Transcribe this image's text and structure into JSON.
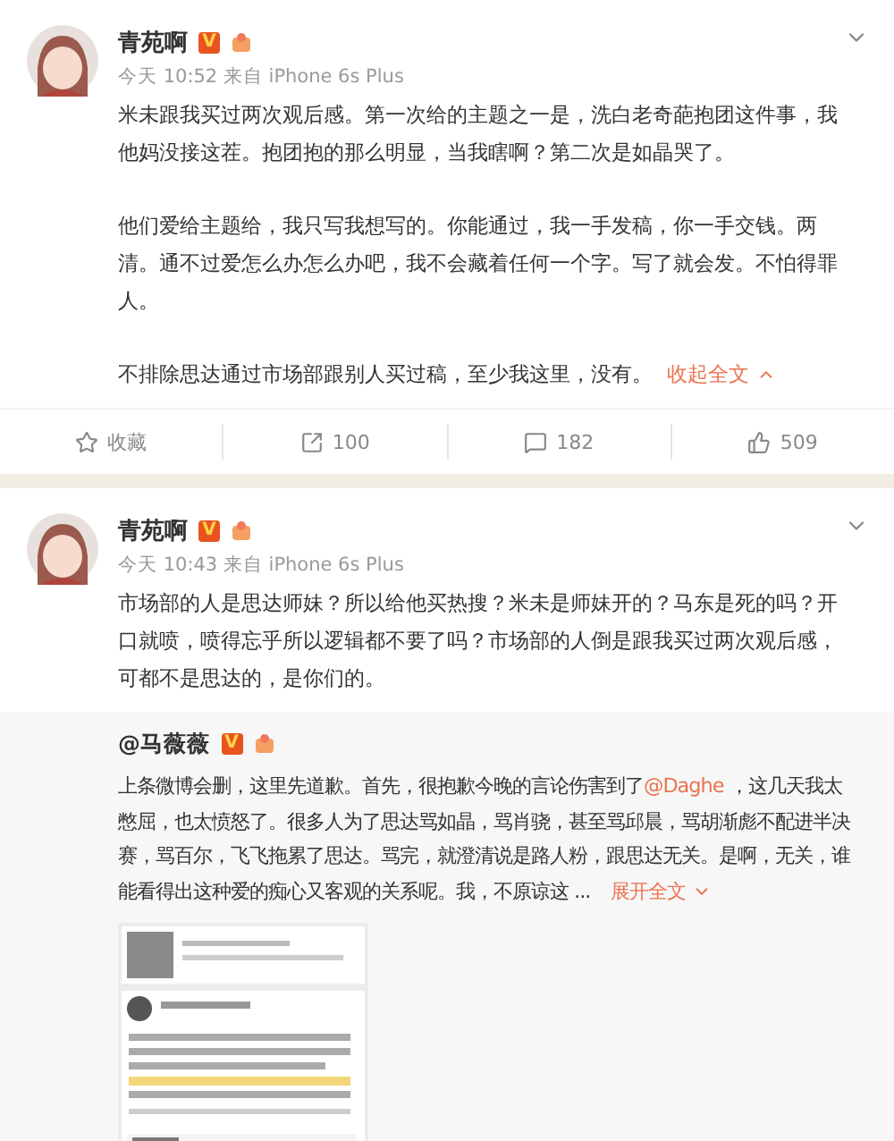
{
  "posts": [
    {
      "author": "青苑啊",
      "verified_badge": "V",
      "meta": "今天 10:52 来自 iPhone 6s Plus",
      "paragraphs": [
        "米未跟我买过两次观后感。第一次给的主题之一是，洗白老奇葩抱团这件事，我他妈没接这茬。抱团抱的那么明显，当我瞎啊？第二次是如晶哭了。",
        "他们爱给主题给，我只写我想写的。你能通过，我一手发稿，你一手交钱。两清。通不过爱怎么办怎么办吧，我不会藏着任何一个字。写了就会发。不怕得罪人。",
        "不排除思达通过市场部跟别人买过稿，至少我这里，没有。"
      ],
      "toggle": {
        "label": "收起全文",
        "expanded": true
      },
      "actions": [
        {
          "kind": "favorite",
          "label": "收藏"
        },
        {
          "kind": "repost",
          "label": "100"
        },
        {
          "kind": "comment",
          "label": "182"
        },
        {
          "kind": "like",
          "label": "509"
        }
      ]
    },
    {
      "author": "青苑啊",
      "verified_badge": "V",
      "meta": "今天 10:43 来自 iPhone 6s Plus",
      "paragraphs": [
        "市场部的人是思达师妹？所以给他买热搜？米未是师妹开的？马东是死的吗？开口就喷，喷得忘乎所以逻辑都不要了吗？市场部的人倒是跟我买过两次观后感，可都不是思达的，是你们的。"
      ],
      "repost": {
        "author": "@马薇薇",
        "verified_badge": "V",
        "segments": [
          {
            "kind": "text",
            "text": "上条微博会删，这里先道歉。首先，很抱歉今晚的言论伤害到了"
          },
          {
            "kind": "mention",
            "text": "@Daghe"
          },
          {
            "kind": "text",
            "text": " ，这几天我太憋屈，也太愤怒了。很多人为了思达骂如晶，骂肖骁，甚至骂邱晨，骂胡渐彪不配进半决赛，骂百尔，飞飞拖累了思达。骂完，就澄清说是路人粉，跟思达无关。是啊，无关，谁能看得出这种爱的痴心又客观的关系呢。我，不原谅这 ... "
          }
        ],
        "toggle": {
          "label": "展开全文",
          "expanded": false
        }
      }
    }
  ]
}
